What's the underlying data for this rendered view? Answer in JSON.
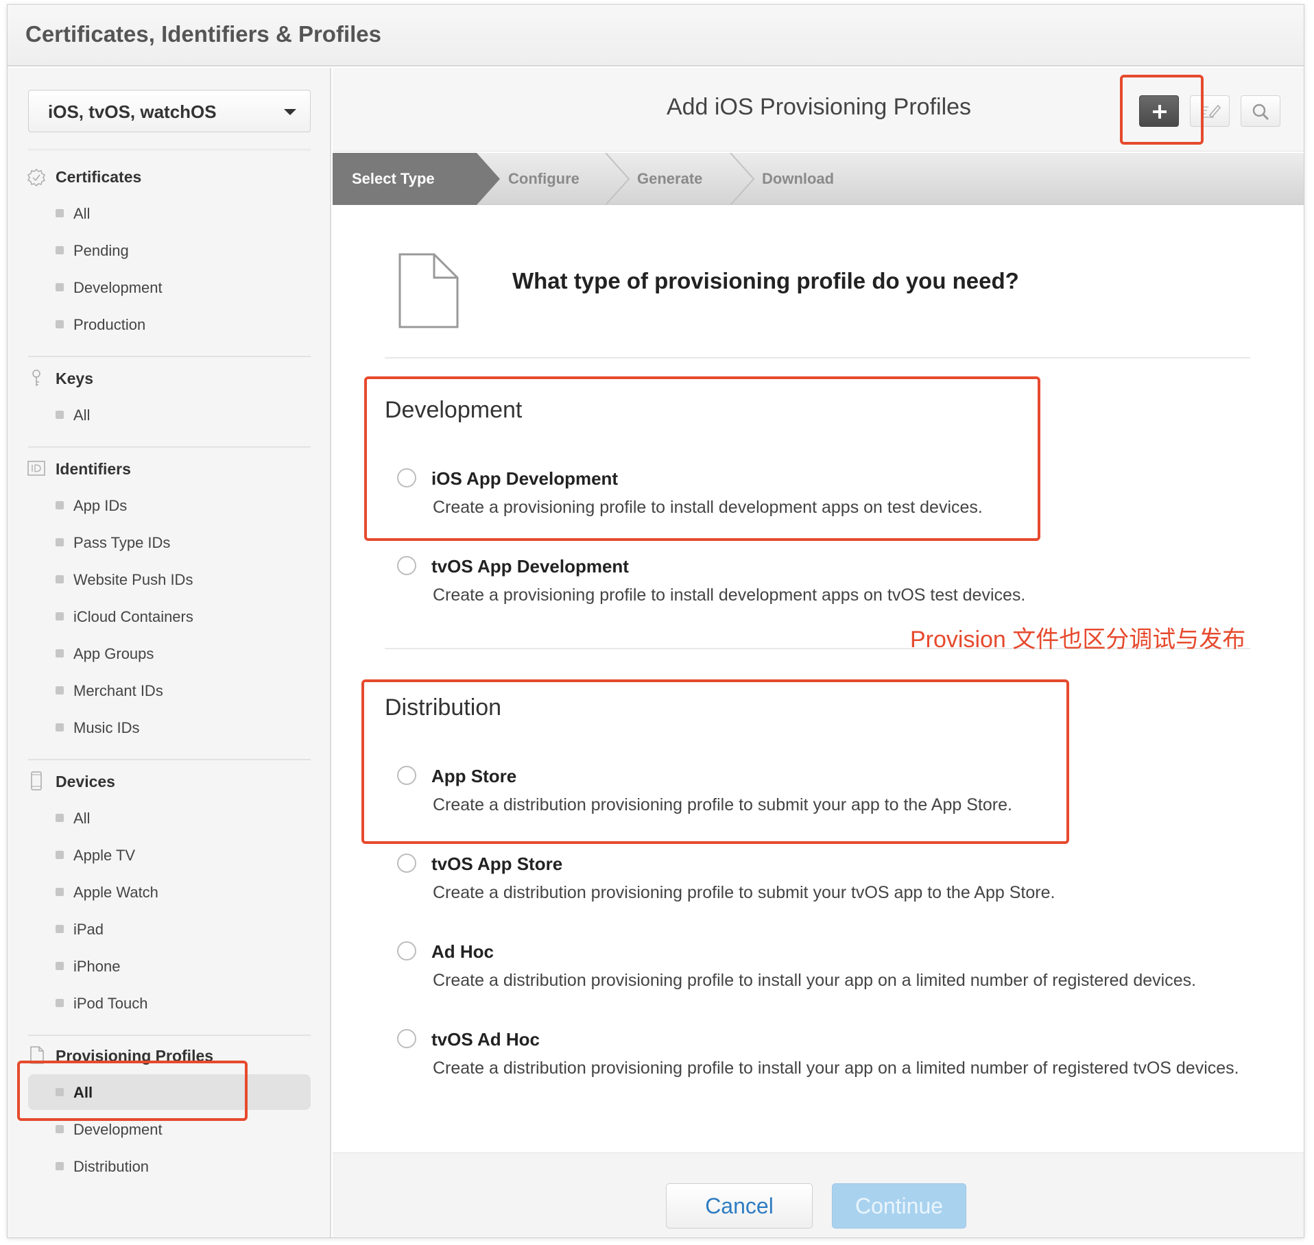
{
  "window": {
    "title": "Certificates, Identifiers & Profiles"
  },
  "sidebar": {
    "platform": "iOS, tvOS, watchOS",
    "certificates": {
      "title": "Certificates",
      "items": [
        "All",
        "Pending",
        "Development",
        "Production"
      ]
    },
    "keys": {
      "title": "Keys",
      "items": [
        "All"
      ]
    },
    "identifiers": {
      "title": "Identifiers",
      "items": [
        "App IDs",
        "Pass Type IDs",
        "Website Push IDs",
        "iCloud Containers",
        "App Groups",
        "Merchant IDs",
        "Music IDs"
      ]
    },
    "devices": {
      "title": "Devices",
      "items": [
        "All",
        "Apple TV",
        "Apple Watch",
        "iPad",
        "iPhone",
        "iPod Touch"
      ]
    },
    "profiles": {
      "title": "Provisioning Profiles",
      "items": [
        "All",
        "Development",
        "Distribution"
      ],
      "selected": "All"
    }
  },
  "main": {
    "title": "Add iOS Provisioning Profiles",
    "toolbar": {
      "add_icon": "plus-icon",
      "edit_icon": "pencil-icon",
      "search_icon": "search-icon"
    },
    "steps": [
      "Select Type",
      "Configure",
      "Generate",
      "Download"
    ],
    "active_step": "Select Type",
    "question": "What type of provisioning profile do you need?",
    "development": {
      "title": "Development",
      "options": [
        {
          "name": "iOS App Development",
          "desc": "Create a provisioning profile to install development apps on test devices."
        },
        {
          "name": "tvOS App Development",
          "desc": "Create a provisioning profile to install development apps on tvOS test devices."
        }
      ]
    },
    "distribution": {
      "title": "Distribution",
      "options": [
        {
          "name": "App Store",
          "desc": "Create a distribution provisioning profile to submit your app to the App Store."
        },
        {
          "name": "tvOS App Store",
          "desc": "Create a distribution provisioning profile to submit your tvOS app to the App Store."
        },
        {
          "name": "Ad Hoc",
          "desc": "Create a distribution provisioning profile to install your app on a limited number of registered devices."
        },
        {
          "name": "tvOS Ad Hoc",
          "desc": "Create a distribution provisioning profile to install your app on a limited number of registered tvOS devices."
        }
      ]
    },
    "annotation": "Provision 文件也区分调试与发布",
    "buttons": {
      "cancel": "Cancel",
      "continue": "Continue"
    }
  },
  "colors": {
    "annotation_red": "#e64a2e",
    "link_blue": "#2f7cc2",
    "continue_disabled": "#a9d2ef"
  }
}
